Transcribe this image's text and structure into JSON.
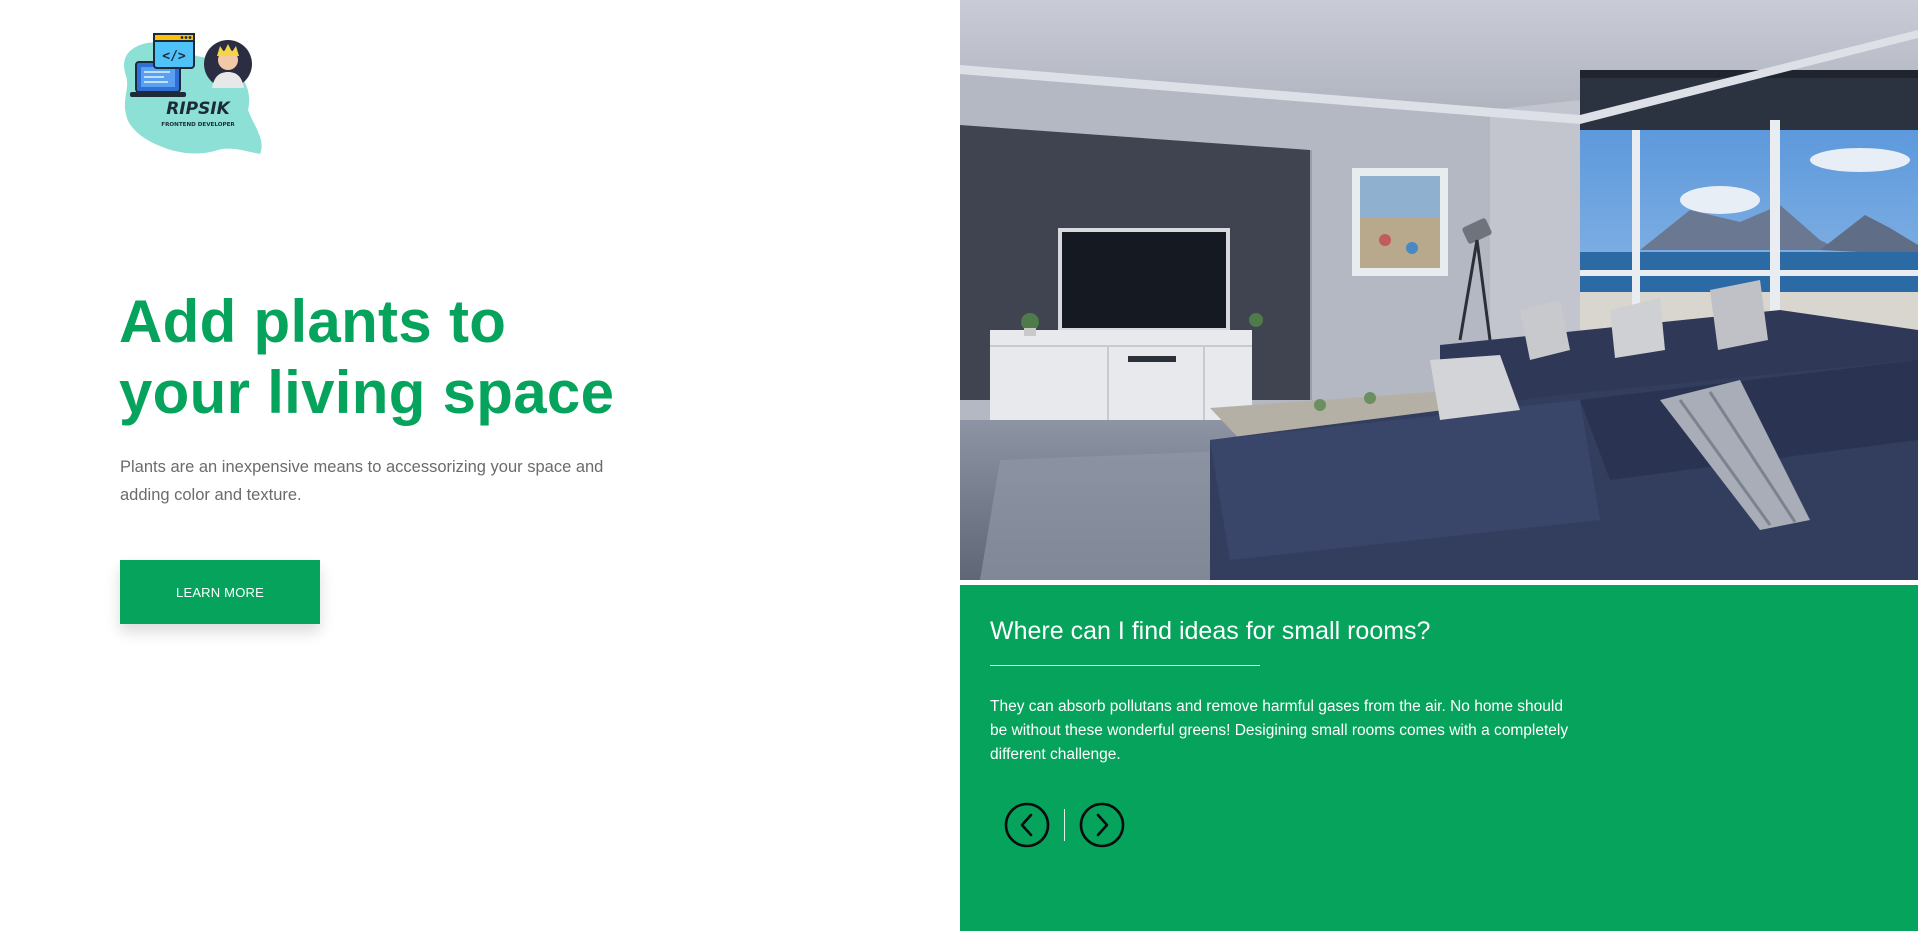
{
  "brand": {
    "logo_name": "RIPSIK",
    "logo_tagline": "FRONTEND DEVELOPER",
    "logo_icon": "code-window-laptop-avatar-logo"
  },
  "hero": {
    "title_line1": "Add plants to",
    "title_line2": "your living space",
    "description": "Plants are an inexpensive means to accessorizing your space and adding color and texture.",
    "cta_label": "LEARN MORE"
  },
  "gallery": {
    "image_subject": "living-room-photo"
  },
  "info": {
    "title": "Where can I find ideas for small rooms?",
    "text": "They can absorb pollutans and remove harmful gases from the air. No home should be without these wonderful greens! Desigining small rooms comes with a completely different challenge.",
    "prev_icon": "chevron-left-circle-icon",
    "next_icon": "chevron-right-circle-icon"
  },
  "colors": {
    "accent": "#05a35b",
    "text_muted": "#6b6b6b",
    "white": "#ffffff"
  }
}
